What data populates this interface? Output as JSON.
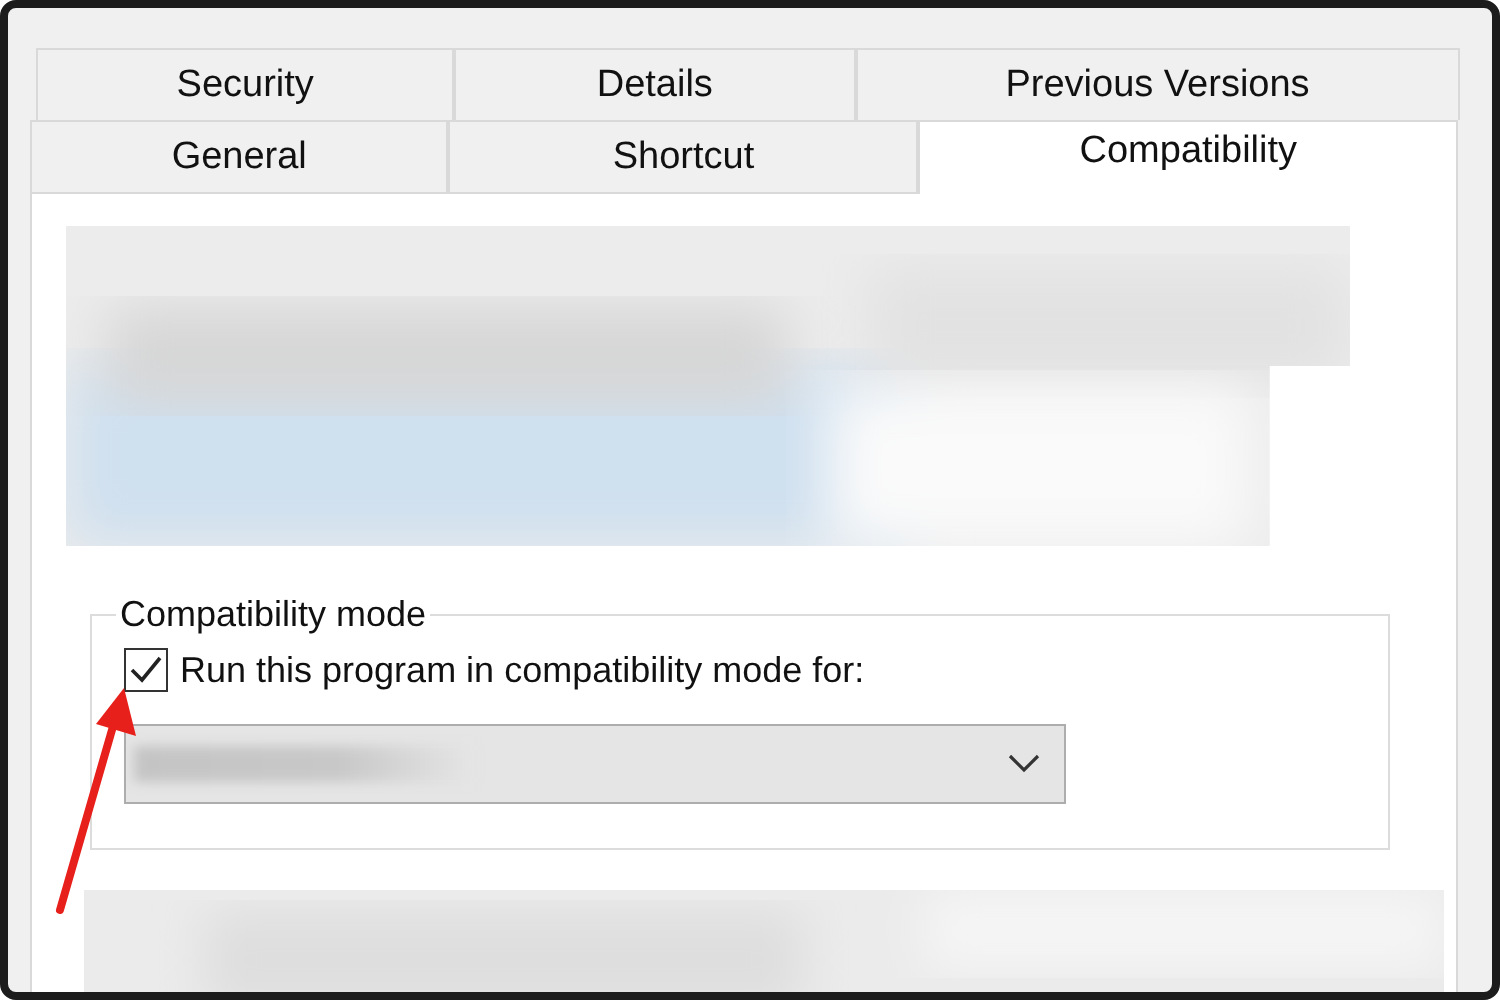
{
  "tab_rows": [
    [
      {
        "label": "Security",
        "selected": false
      },
      {
        "label": "Details",
        "selected": false
      },
      {
        "label": "Previous Versions",
        "selected": false
      }
    ],
    [
      {
        "label": "General",
        "selected": false
      },
      {
        "label": "Shortcut",
        "selected": false
      },
      {
        "label": "Compatibility",
        "selected": true
      }
    ]
  ],
  "compatibility_mode": {
    "title": "Compatibility mode",
    "checkbox": {
      "label": "Run this program in compatibility mode for:",
      "checked": true
    }
  }
}
